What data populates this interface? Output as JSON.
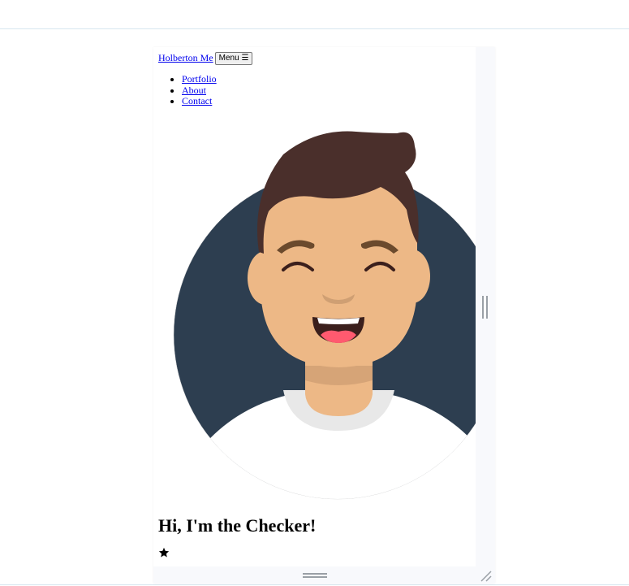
{
  "nav": {
    "brand": "Holberton Me",
    "menu_button": "Menu",
    "menu_icon": "hamburger-icon",
    "items": [
      {
        "label": "Portfolio"
      },
      {
        "label": "About"
      },
      {
        "label": "Contact"
      }
    ]
  },
  "hero": {
    "headline": "Hi, I'm the Checker!",
    "star_icon": "star-icon"
  },
  "colors": {
    "circle_bg": "#2d3e50",
    "hair": "#4a2f2b",
    "skin": "#edb886",
    "skin_shadow": "#d6a477",
    "shirt": "#ffffff",
    "collar": "#e8e8e8",
    "mouth": "#3b1f1c",
    "tongue": "#ff5a6f"
  }
}
